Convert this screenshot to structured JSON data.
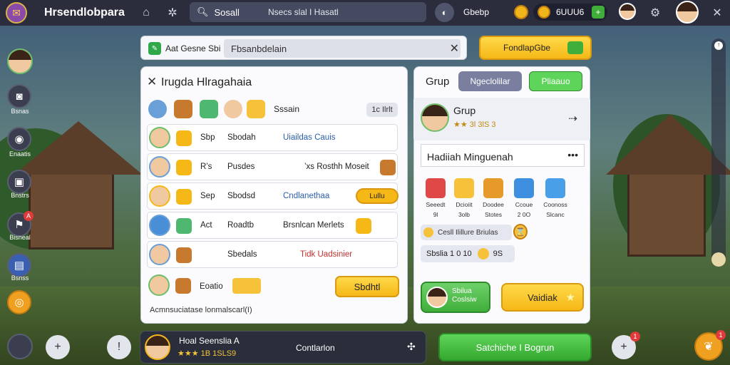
{
  "colors": {
    "topbar": "#2b2d3c",
    "accent_gold": "#f5b817",
    "accent_green": "#3fae3a",
    "link_blue": "#2a5ea8"
  },
  "topbar": {
    "title": "Hrsendlobpara",
    "search_label": "Sosall",
    "search_placeholder": "Nsecs slal I Hasatl",
    "mode_label": "Gbebp",
    "currency_value": "6UUU6"
  },
  "sidebar": [
    {
      "label": "",
      "icon": "player-avatar-icon"
    },
    {
      "label": "Bsnas",
      "icon": "camera-icon"
    },
    {
      "label": "Enaatis",
      "icon": "eye-icon"
    },
    {
      "label": "Bnstrs",
      "icon": "gift-box-icon"
    },
    {
      "label": "Bisneal",
      "icon": "flag-icon",
      "badge": "A"
    },
    {
      "label": "Bsnss",
      "icon": "ticket-icon"
    },
    {
      "label": "",
      "icon": "donut-icon"
    }
  ],
  "tip": {
    "label": "Aat Gesne Sbi",
    "value": "Fbsanbdelain"
  },
  "gold_button": "FondlapGbe",
  "left_panel": {
    "title": "Irugda Hlragahaia",
    "filter_label": "Sssain",
    "filter_chip": "1c Ilrlt",
    "rows": [
      {
        "a": "Sbp",
        "b": "Sbodah",
        "c": "Uiaildas Cauis",
        "button": ""
      },
      {
        "a": "R’s",
        "b": "Pusdes",
        "c": "’xs Rosthh Moseit",
        "button": ""
      },
      {
        "a": "Sep",
        "b": "Sbodsd",
        "c": "Cndlanethaa",
        "button": "Lullu"
      },
      {
        "a": "Act",
        "b": "Roadtb",
        "c": "Brsnlcan Merlets",
        "button": ""
      },
      {
        "a": "",
        "b": "Sbedals",
        "c": "Tidk Uadsinier",
        "button": ""
      },
      {
        "a": "Eoatio",
        "b": "",
        "c": "",
        "button": ""
      }
    ],
    "claim_button": "Sbdhtl",
    "footnote": "Acmnsuciatase lonmalscarl(I)"
  },
  "right_panel": {
    "title": "Grup",
    "tab1": "Ngeclolilar",
    "tab2": "Pliaauo",
    "group_name": "Grup",
    "group_stars": "★★ 3l 3lS 3",
    "reward_title": "Hadiiah Minguenah",
    "rewards": [
      {
        "name": "Seeedt",
        "count": "9l"
      },
      {
        "name": "Dcioiit",
        "count": "3olb"
      },
      {
        "name": "Doodee",
        "count": "Stotes"
      },
      {
        "name": "Ccoue",
        "count": "2 0O"
      },
      {
        "name": "Coonoss",
        "count": "Slcanc"
      }
    ],
    "cost_label": "Cesll Ilillure Briulas",
    "price_a": "Sbslia 1 0 10",
    "price_b": "9S",
    "green_card": "Sbilua Coslsiw",
    "yellow_card": "Vaidiak"
  },
  "bottom": {
    "player_name": "Hoal Seenslia A",
    "player_stars": "★★★ 1B 1SLS9",
    "player_status": "Contlarlon",
    "big_button": "Satchiche I Bogrun"
  }
}
